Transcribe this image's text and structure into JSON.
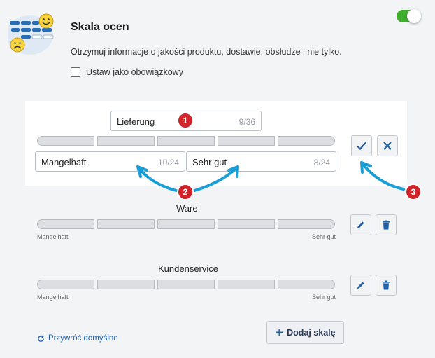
{
  "header": {
    "title": "Skala ocen",
    "description": "Otrzymuj informacje o jakości produktu, dostawie, obsłudze i nie tylko.",
    "required_label": "Ustaw jako obowiązkowy",
    "required_checked": false,
    "enabled": true
  },
  "edit_scale": {
    "title_value": "Lieferung",
    "title_count": "9/36",
    "low_value": "Mangelhaft",
    "low_count": "10/24",
    "high_value": "Sehr gut",
    "high_count": "8/24",
    "segments": 5
  },
  "scales": [
    {
      "title": "Ware",
      "low_label": "Mangelhaft",
      "high_label": "Sehr gut"
    },
    {
      "title": "Kundenservice",
      "low_label": "Mangelhaft",
      "high_label": "Sehr gut"
    }
  ],
  "footer": {
    "restore_label": "Przywróć domyślne",
    "add_label": "Dodaj skalę"
  },
  "annotations": {
    "badge_1": "1",
    "badge_2": "2",
    "badge_3": "3"
  },
  "colors": {
    "accent": "#1f5fa8",
    "toggle": "#3fae2e",
    "badge": "#d1232a",
    "arrow": "#1a9ed6"
  },
  "icons": [
    "rating-scale-logo",
    "check-icon",
    "close-icon",
    "pencil-icon",
    "trash-icon",
    "refresh-icon",
    "plus-icon"
  ]
}
